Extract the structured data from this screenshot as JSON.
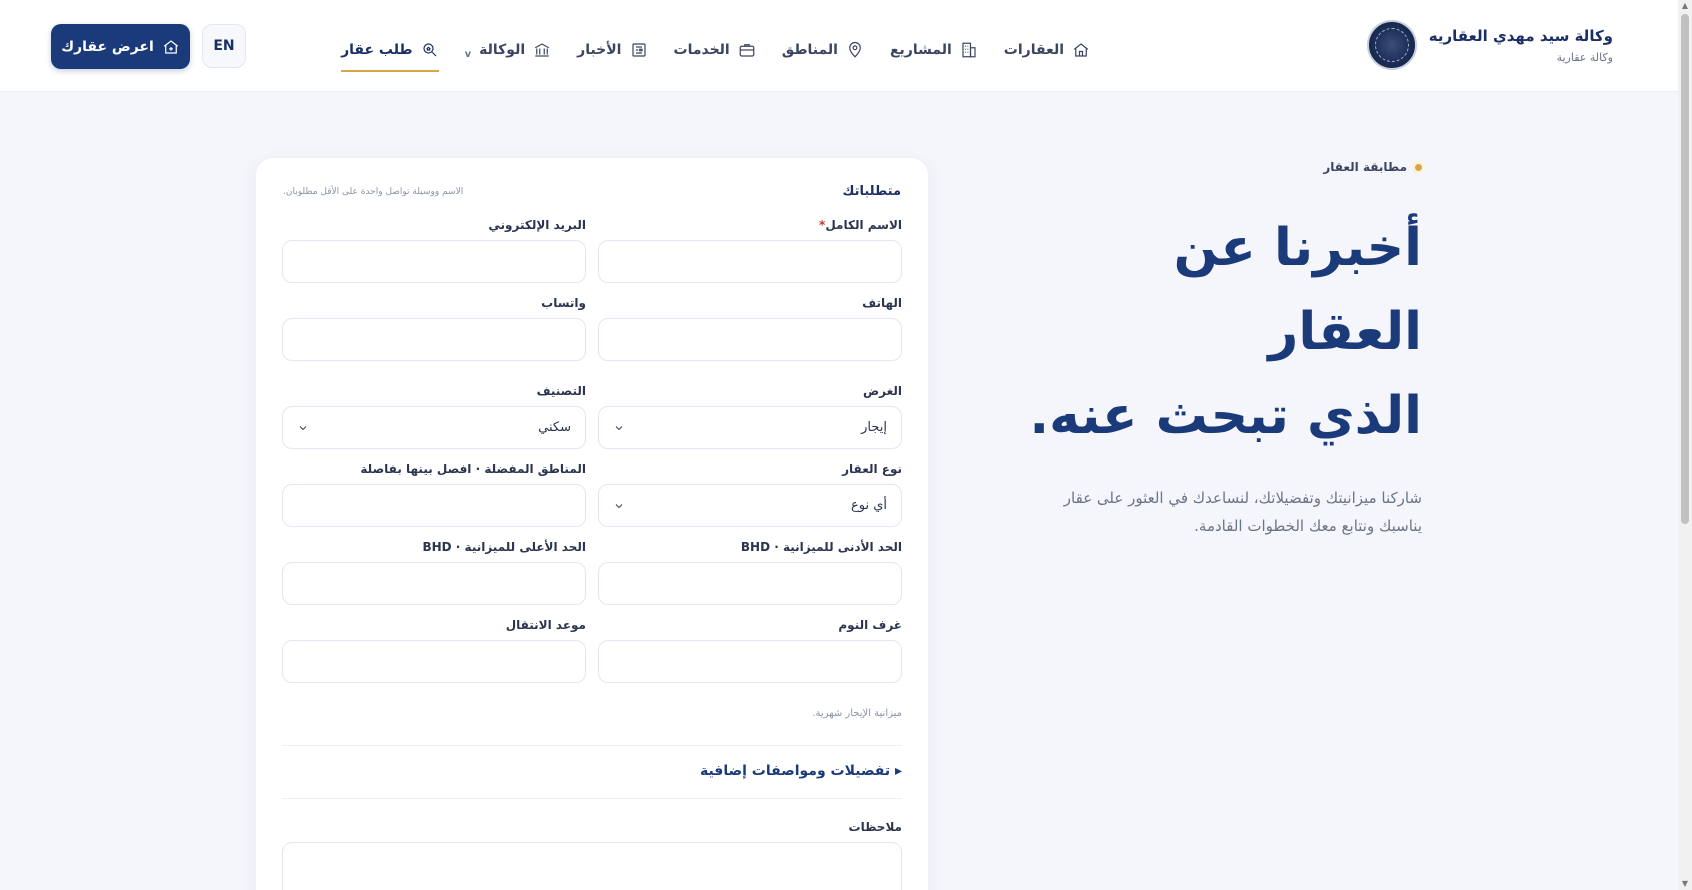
{
  "header": {
    "brand_name": "وكالة سيد مهدي العقاريه",
    "brand_sub": "وكالة عقارية",
    "nav": [
      {
        "label": "العقارات",
        "icon": "home-icon"
      },
      {
        "label": "المشاريع",
        "icon": "building-icon"
      },
      {
        "label": "المناطق",
        "icon": "map-pin-icon"
      },
      {
        "label": "الخدمات",
        "icon": "briefcase-icon"
      },
      {
        "label": "الأخبار",
        "icon": "newspaper-icon"
      },
      {
        "label": "الوكالة",
        "icon": "bank-icon",
        "caret": "v"
      },
      {
        "label": "طلب عقار",
        "icon": "search-home-icon"
      }
    ],
    "lang": "EN",
    "cta": "اعرض عقارك"
  },
  "hero": {
    "eyebrow": "مطابقة العقار",
    "title_line1": "أخبرنا عن العقار",
    "title_line2": "الذي تبحث عنه.",
    "desc": "شاركنا ميزانيتك وتفضيلاتك، لنساعدك في العثور على عقار يناسبك ونتابع معك الخطوات القادمة."
  },
  "form": {
    "title": "متطلباتك",
    "note": "الاسم ووسيلة تواصل واحدة على الأقل مطلوبان.",
    "full_name_label": "الاسم الكامل",
    "required_mark": "*",
    "email_label": "البريد الإلكتروني",
    "phone_label": "الهاتف",
    "whatsapp_label": "واتساب",
    "purpose_label": "الغرض",
    "purpose_value": "إيجار",
    "category_label": "التصنيف",
    "category_value": "سكني",
    "type_label": "نوع العقار",
    "type_value": "أي نوع",
    "areas_label": "المناطق المفضلة · افصل بينها بفاصلة",
    "min_budget_label": "الحد الأدنى للميزانية · BHD",
    "max_budget_label": "الحد الأعلى للميزانية · BHD",
    "bedrooms_label": "غرف النوم",
    "move_date_label": "موعد الانتقال",
    "budget_hint": "ميزانية الإيجار شهرية.",
    "extra_toggle": "▸ تفضيلات ومواصفات إضافية",
    "notes_label": "ملاحظات"
  }
}
